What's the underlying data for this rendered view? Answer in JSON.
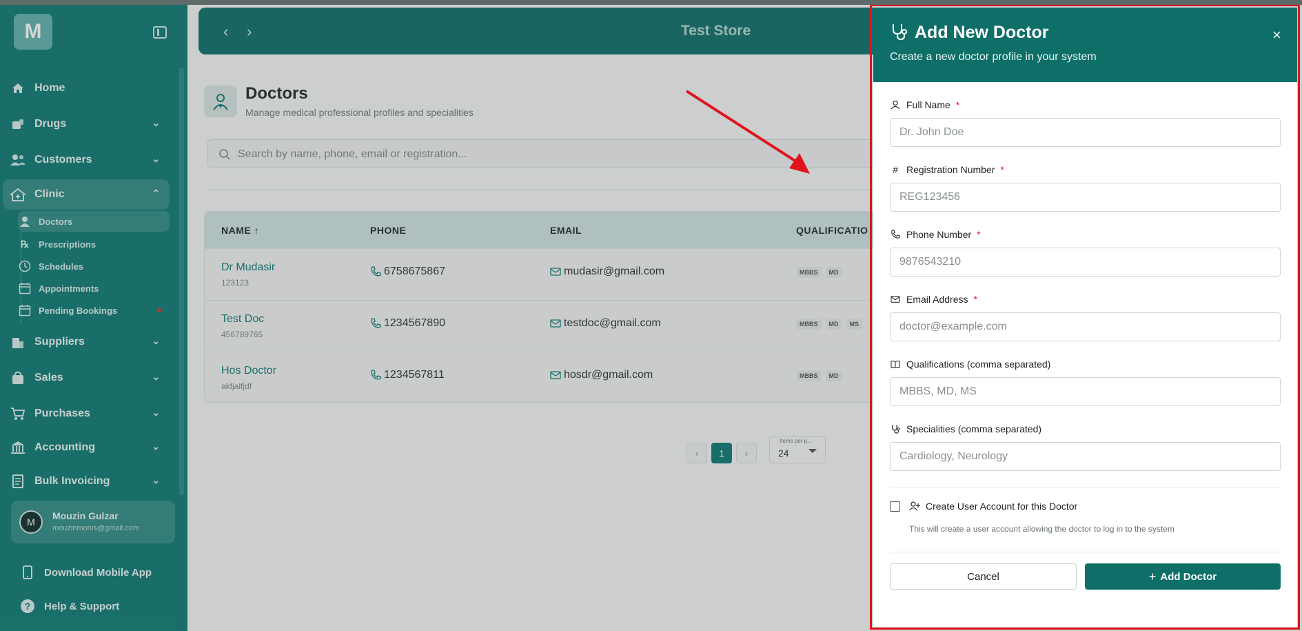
{
  "sidebar": {
    "logo": "M",
    "items": [
      {
        "label": "Home"
      },
      {
        "label": "Drugs"
      },
      {
        "label": "Customers"
      },
      {
        "label": "Clinic"
      },
      {
        "label": "Suppliers"
      },
      {
        "label": "Sales"
      },
      {
        "label": "Purchases"
      },
      {
        "label": "Accounting"
      },
      {
        "label": "Bulk Invoicing"
      }
    ],
    "clinic_sub": [
      {
        "label": "Doctors"
      },
      {
        "label": "Prescriptions"
      },
      {
        "label": "Schedules"
      },
      {
        "label": "Appointments"
      },
      {
        "label": "Pending Bookings"
      }
    ],
    "user": {
      "initial": "M",
      "name": "Mouzin Gulzar",
      "email": "mouzinmonis@gmail.com"
    },
    "download_label": "Download Mobile App",
    "help_label": "Help & Support"
  },
  "header": {
    "store": "Test Store"
  },
  "page": {
    "title": "Doctors",
    "subtitle": "Manage medical professional profiles and specialities",
    "search_placeholder": "Search by name, phone, email or registration..."
  },
  "table": {
    "headers": {
      "name": "NAME ↑",
      "phone": "PHONE",
      "email": "EMAIL",
      "qual": "QUALIFICATIO"
    },
    "rows": [
      {
        "name": "Dr Mudasir",
        "reg": "123123",
        "phone": "6758675867",
        "email": "mudasir@gmail.com",
        "quals": [
          "MBBS",
          "MD"
        ]
      },
      {
        "name": "Test Doc",
        "reg": "456789765",
        "phone": "1234567890",
        "email": "testdoc@gmail.com",
        "quals": [
          "MBBS",
          "MD",
          "MS"
        ]
      },
      {
        "name": "Hos Doctor",
        "reg": "akfjalfjdf",
        "phone": "1234567811",
        "email": "hosdr@gmail.com",
        "quals": [
          "MBBS",
          "MD"
        ]
      }
    ]
  },
  "pagination": {
    "current": "1",
    "items_label": "Items per p...",
    "items_value": "24"
  },
  "dialog": {
    "title": "Add New Doctor",
    "subtitle": "Create a new doctor profile in your system",
    "close": "×",
    "fields": {
      "full_name": {
        "label": "Full Name",
        "placeholder": "Dr. John Doe",
        "required": "*"
      },
      "registration": {
        "label": "Registration Number",
        "placeholder": "REG123456",
        "required": "*"
      },
      "phone": {
        "label": "Phone Number",
        "placeholder": "9876543210",
        "required": "*"
      },
      "email": {
        "label": "Email Address",
        "placeholder": "doctor@example.com",
        "required": "*"
      },
      "qualifications": {
        "label": "Qualifications (comma separated)",
        "placeholder": "MBBS, MD, MS"
      },
      "specialities": {
        "label": "Specialities (comma separated)",
        "placeholder": "Cardiology, Neurology"
      }
    },
    "create_account_label": "Create User Account for this Doctor",
    "create_account_help": "This will create a user account allowing the doctor to log in to the system",
    "cancel_label": "Cancel",
    "add_label": "Add Doctor"
  },
  "colors": {
    "primary": "#0e6f69",
    "sidebar": "#0e7a74",
    "required": "#e0141e",
    "highlight": "#e0141e"
  }
}
